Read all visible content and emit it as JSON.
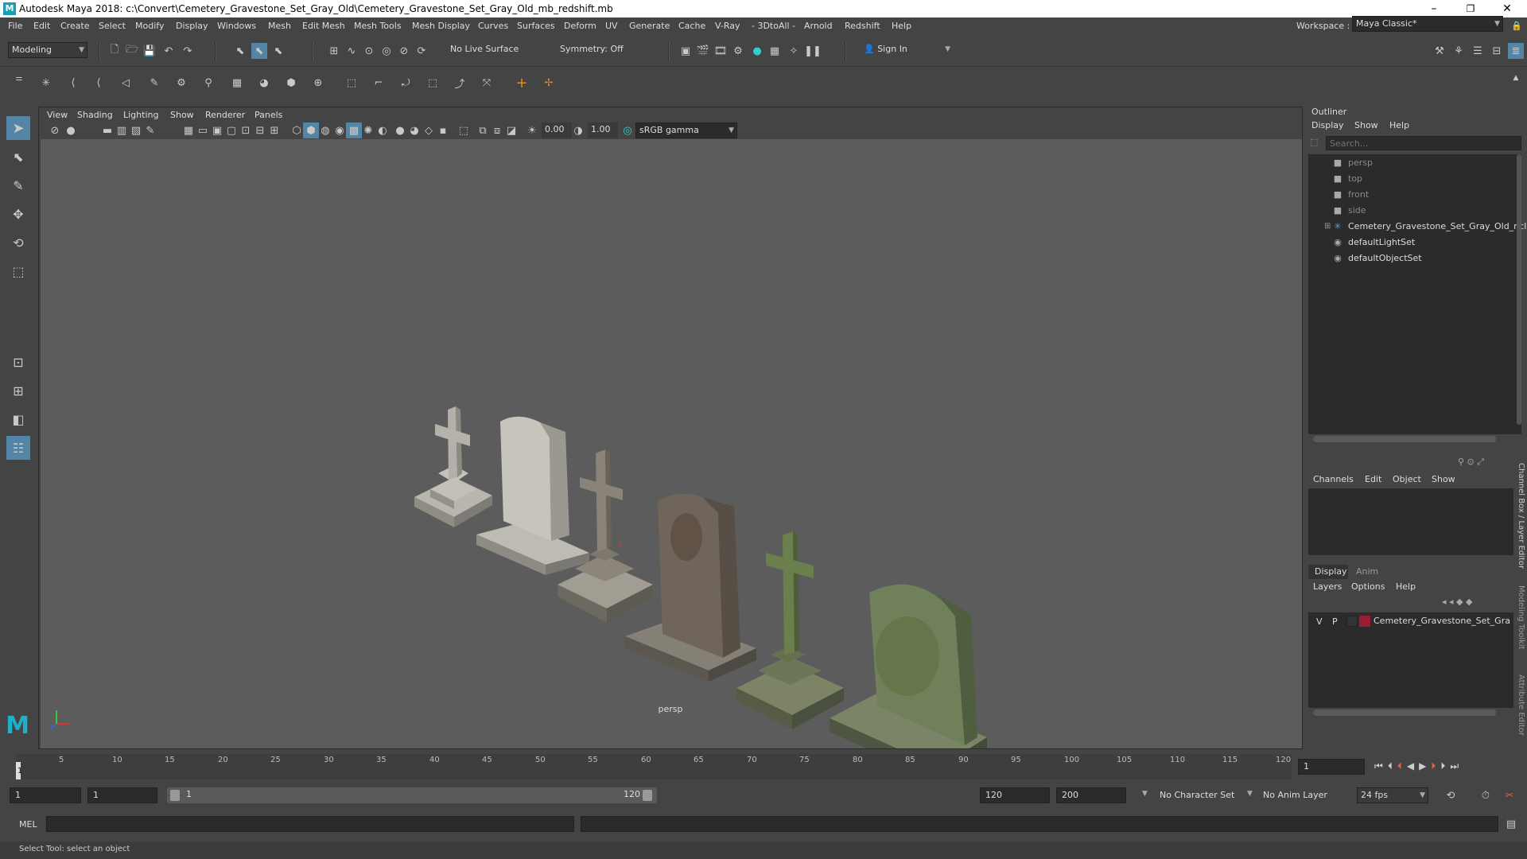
{
  "window": {
    "title": "Autodesk Maya 2018: c:\\Convert\\Cemetery_Gravestone_Set_Gray_Old\\Cemetery_Gravestone_Set_Gray_Old_mb_redshift.mb",
    "logo": "M",
    "minimize": "–",
    "maximize": "❐",
    "close": "✕"
  },
  "menubar": {
    "items": [
      "File",
      "Edit",
      "Create",
      "Select",
      "Modify",
      "Display",
      "Windows",
      "Mesh",
      "Edit Mesh",
      "Mesh Tools",
      "Mesh Display",
      "Curves",
      "Surfaces",
      "Deform",
      "UV",
      "Generate",
      "Cache",
      "V-Ray",
      "- 3DtoAll -",
      "Arnold",
      "Redshift",
      "Help"
    ],
    "workspace_label": "Workspace :",
    "workspace_value": "Maya Classic*"
  },
  "statusline": {
    "mode": "Modeling",
    "live_surface": "No Live Surface",
    "symmetry": "Symmetry: Off",
    "sign_in": "Sign In"
  },
  "viewport": {
    "menu": [
      "View",
      "Shading",
      "Lighting",
      "Show",
      "Renderer",
      "Panels"
    ],
    "exposure": "0.00",
    "gamma": "1.00",
    "color_space": "sRGB gamma",
    "camera_label": "persp"
  },
  "outliner": {
    "title": "Outliner",
    "menu": [
      "Display",
      "Show",
      "Help"
    ],
    "search_placeholder": "Search...",
    "items": [
      {
        "label": "persp",
        "icon": "camera-icon",
        "dim": true
      },
      {
        "label": "top",
        "icon": "camera-icon",
        "dim": true
      },
      {
        "label": "front",
        "icon": "camera-icon",
        "dim": true
      },
      {
        "label": "side",
        "icon": "camera-icon",
        "dim": true
      },
      {
        "label": "Cemetery_Gravestone_Set_Gray_Old_ncl",
        "icon": "group-icon",
        "dim": false
      },
      {
        "label": "defaultLightSet",
        "icon": "set-icon",
        "dim": false
      },
      {
        "label": "defaultObjectSet",
        "icon": "set-icon",
        "dim": false
      }
    ]
  },
  "channelbox": {
    "menu": [
      "Channels",
      "Edit",
      "Object",
      "Show"
    ],
    "tabs": [
      "Display",
      "Anim"
    ],
    "layer_menu": [
      "Layers",
      "Options",
      "Help"
    ],
    "layer": {
      "v": "V",
      "p": "P",
      "name": "Cemetery_Gravestone_Set_Gra",
      "color": "#9b1b30"
    },
    "side_tabs": [
      "Channel Box / Layer Editor",
      "Modeling Toolkit",
      "Attribute Editor"
    ]
  },
  "timeline": {
    "ticks": [
      "5",
      "10",
      "15",
      "20",
      "25",
      "30",
      "35",
      "40",
      "45",
      "50",
      "55",
      "60",
      "65",
      "70",
      "75",
      "80",
      "85",
      "90",
      "95",
      "100",
      "105",
      "110",
      "115",
      "120"
    ],
    "start_marker": "1",
    "current_frame": "1"
  },
  "rangebar": {
    "start": "1",
    "playback_start": "1",
    "slider_start": "1",
    "slider_end": "120",
    "playback_end": "120",
    "end": "200",
    "character_set": "No Character Set",
    "anim_layer": "No Anim Layer",
    "fps": "24 fps"
  },
  "mel": {
    "label": "MEL"
  },
  "helpline": {
    "text": "Select Tool: select an object"
  },
  "colors": {
    "accent": "#5285a6",
    "viewport_bg": "#5c5c5c",
    "panel_bg": "#444444",
    "field_bg": "#2b2b2b"
  }
}
